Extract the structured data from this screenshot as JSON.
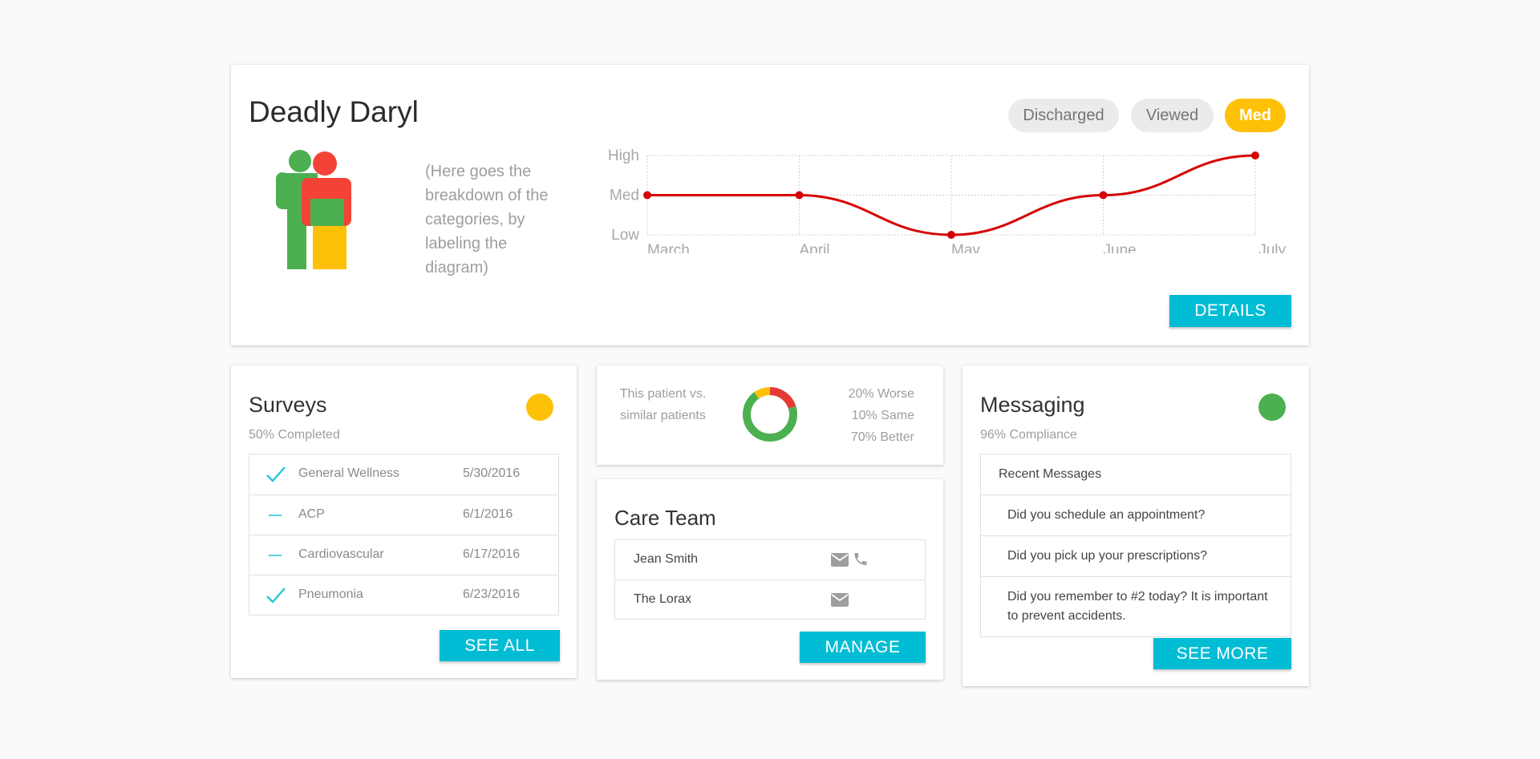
{
  "patient": {
    "name": "Deadly Daryl",
    "description": "(Here goes the breakdown of the categories, by labeling the diagram)",
    "badges": [
      {
        "label": "Discharged",
        "active": false
      },
      {
        "label": "Viewed",
        "active": false
      },
      {
        "label": "Med",
        "active": true
      }
    ],
    "details_label": "DETAILS",
    "colors": {
      "green": "#4caf50",
      "red": "#f44336",
      "yellow": "#ffc107",
      "line": "#d50000",
      "accent": "#00bcd4"
    }
  },
  "chart_data": {
    "type": "line",
    "categories": [
      "March",
      "April",
      "May",
      "June",
      "July"
    ],
    "y_categories": [
      "Low",
      "Med",
      "High"
    ],
    "series": [
      {
        "values": [
          2,
          2,
          1,
          2,
          3
        ]
      }
    ],
    "title": "",
    "xlabel": "",
    "ylabel": "",
    "ylim": [
      1,
      3
    ],
    "grid": true,
    "line_color": "#d50000",
    "smooth": true
  },
  "surveys": {
    "title": "Surveys",
    "completed": "50% Completed",
    "status_color": "#ffc107",
    "items": [
      {
        "status": "check",
        "name": "General Wellness",
        "date": "5/30/2016"
      },
      {
        "status": "dash",
        "name": "ACP",
        "date": "6/1/2016"
      },
      {
        "status": "dash",
        "name": "Cardiovascular",
        "date": "6/17/2016"
      },
      {
        "status": "check",
        "name": "Pneumonia",
        "date": "6/23/2016"
      }
    ],
    "button_label": "SEE ALL"
  },
  "comparison": {
    "label": "This patient vs. similar patients",
    "stats": [
      "20% Worse",
      "10% Same",
      "70% Better"
    ],
    "donut": [
      {
        "name": "Worse",
        "value": 20,
        "color": "#e53935"
      },
      {
        "name": "Better",
        "value": 70,
        "color": "#4caf50"
      },
      {
        "name": "Same",
        "value": 10,
        "color": "#ffc107"
      }
    ]
  },
  "care_team": {
    "title": "Care Team",
    "members": [
      {
        "name": "Jean Smith",
        "icons": [
          "mail-icon",
          "phone-icon"
        ]
      },
      {
        "name": "The Lorax",
        "icons": [
          "mail-icon"
        ]
      }
    ],
    "button_label": "MANAGE"
  },
  "messaging": {
    "title": "Messaging",
    "compliance": "96% Compliance",
    "status_color": "#4caf50",
    "header": "Recent Messages",
    "messages": [
      "Did you schedule an appointment?",
      "Did you pick up your prescriptions?",
      "Did you remember to #2 today? It is important to prevent accidents."
    ],
    "button_label": "SEE MORE"
  }
}
